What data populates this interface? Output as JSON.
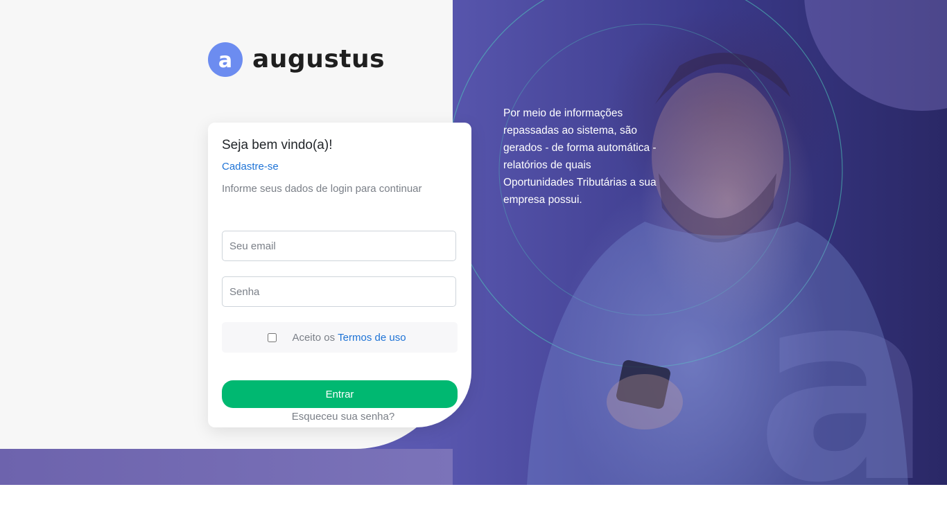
{
  "logo": {
    "mark_letter": "a",
    "text": "augustus",
    "mark_color": "#6c8cf0"
  },
  "login": {
    "title": "Seja bem vindo(a)!",
    "signup_link": "Cadastre-se",
    "subtitle": "Informe seus dados de login para continuar",
    "email_placeholder": "Seu email",
    "password_placeholder": "Senha",
    "terms_prefix": "Aceito os",
    "terms_link": "Termos de uso",
    "submit_label": "Entrar",
    "forgot_link": "Esqueceu sua senha?"
  },
  "promo": {
    "text": "Por meio de informações repassadas ao sistema, são gerados - de forma automática - relatórios de quais Oportunidades Tributárias a sua empresa possui."
  },
  "colors": {
    "accent_green": "#00b871",
    "link_blue": "#1e73d6",
    "panel_purple": "#5a58b0"
  }
}
